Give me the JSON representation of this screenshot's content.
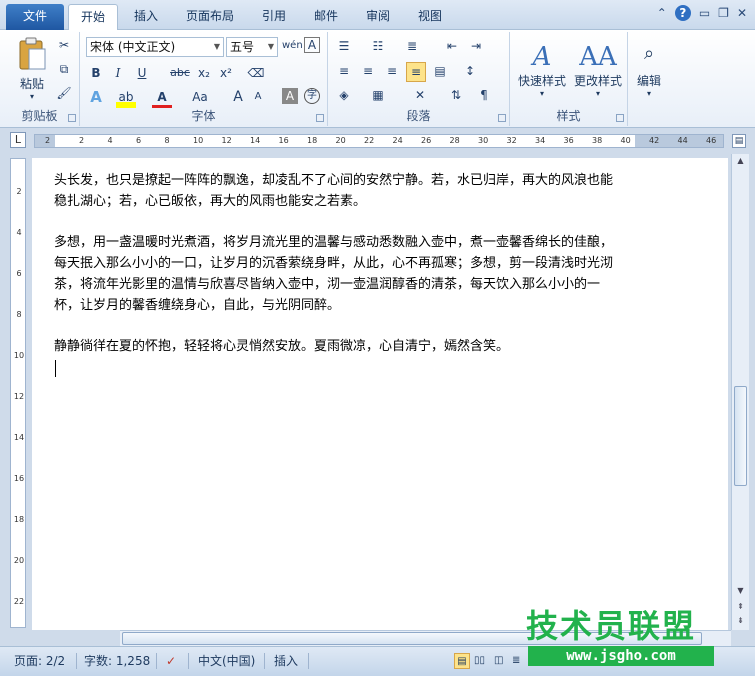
{
  "tabs": [
    "文件",
    "开始",
    "插入",
    "页面布局",
    "引用",
    "邮件",
    "审阅",
    "视图"
  ],
  "ribbon": {
    "clipboard": {
      "label": "剪贴板",
      "paste_label": "粘贴"
    },
    "font": {
      "label": "字体",
      "font_name": "宋体 (中文正文)",
      "font_size": "五号",
      "bold": "B",
      "italic": "I",
      "underline": "U",
      "strike": "abc",
      "subscript": "x₂",
      "superscript": "x²",
      "change_case": "Aa",
      "grow": "A",
      "shrink": "A",
      "font_color": "A"
    },
    "paragraph": {
      "label": "段落"
    },
    "styles": {
      "label": "样式",
      "quick_styles": "快速样式",
      "change_styles": "更改样式"
    },
    "editing": {
      "label": "编辑"
    }
  },
  "ruler": {
    "h_ticks": [
      "2",
      "2",
      "4",
      "6",
      "8",
      "10",
      "12",
      "14",
      "16",
      "18",
      "20",
      "22",
      "24",
      "26",
      "28",
      "30",
      "32",
      "34",
      "36",
      "38",
      "40",
      "42",
      "44",
      "46"
    ],
    "v_ticks": [
      "2",
      "4",
      "6",
      "8",
      "10",
      "12",
      "14",
      "16",
      "18",
      "20",
      "22"
    ]
  },
  "document": {
    "paragraphs": [
      "头长发，也只是撩起一阵阵的飘逸，却凌乱不了心间的安然宁静。若，水已归岸，再大的风浪也能稳扎湖心；若，心已皈依，再大的风雨也能安之若素。",
      "多想，用一盏温暖时光煮酒，将岁月流光里的温馨与感动悉数融入壶中，煮一壶馨香绵长的佳酿，每天抿入那么小小的一口，让岁月的沉香萦绕身畔，从此，心不再孤寒；多想，剪一段清浅时光沏茶，将流年光影里的温情与欣喜尽皆纳入壶中，沏一壶温润醇香的清茶，每天饮入那么小小的一杯，让岁月的馨香缠绕身心，自此，与光阴同醉。",
      "静静徜徉在夏的怀抱，轻轻将心灵悄然安放。夏雨微凉，心自清宁，嫣然含笑。"
    ]
  },
  "status": {
    "page": "页面: 2/2",
    "words": "字数: 1,258",
    "language": "中文(中国)",
    "mode": "插入"
  },
  "watermark": {
    "title": "技术员联盟",
    "url": "www.jsgho.com"
  },
  "colors": {
    "accent": "#2b579a",
    "watermark_green": "#22b24c"
  }
}
